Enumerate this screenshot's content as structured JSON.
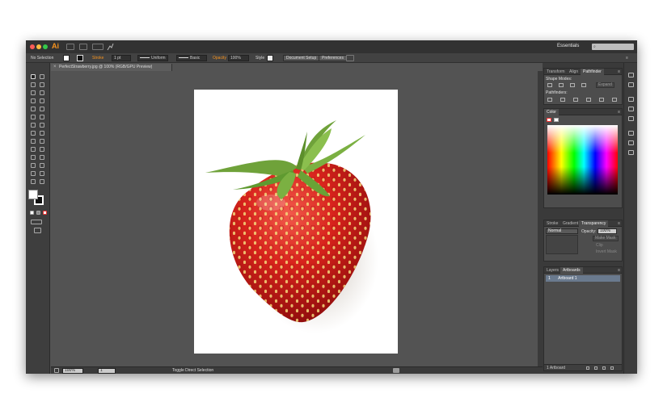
{
  "app": {
    "logo": "Ai",
    "workspace": "Essentials",
    "search_placeholder": "⌕"
  },
  "controlbar": {
    "selection": "No Selection",
    "stroke_label": "Stroke",
    "stroke_weight": "1 pt",
    "profile": "Uniform",
    "brush": "Basic",
    "opacity_label": "Opacity",
    "opacity_value": "100%",
    "style_label": "Style",
    "document_setup": "Document Setup",
    "preferences": "Preferences",
    "colors": {
      "fill": "#ffffff",
      "stroke": "#111111",
      "accent": "#f7931e"
    }
  },
  "document": {
    "tab_title": "PerfectStrawberry.jpg @ 100% (RGB/GPU Preview)",
    "close_glyph": "×"
  },
  "statusbar": {
    "zoom": "100%",
    "artboard_number": "1",
    "status": "Toggle Direct Selection"
  },
  "panels": {
    "pathfinder": {
      "tabs": [
        "Transform",
        "Align",
        "Pathfinder"
      ],
      "active_tab": "Pathfinder",
      "shape_modes_label": "Shape Modes:",
      "expand_button": "Expand",
      "pathfinders_label": "Pathfinders:"
    },
    "color": {
      "tab": "Color"
    },
    "transparency": {
      "tabs": [
        "Stroke",
        "Gradient",
        "Transparency"
      ],
      "active_tab": "Transparency",
      "blend_mode": "Normal",
      "opacity_label": "Opacity:",
      "opacity_value": "100%",
      "make_mask": "Make Mask",
      "clip": "Clip",
      "invert_mask": "Invert Mask"
    },
    "layers": {
      "tabs": [
        "Layers",
        "Artboards"
      ],
      "active_tab": "Artboards",
      "row_number": "1",
      "row_name": "Artboard 1",
      "footer": "1 Artboard"
    },
    "menu_glyph": "≡"
  }
}
